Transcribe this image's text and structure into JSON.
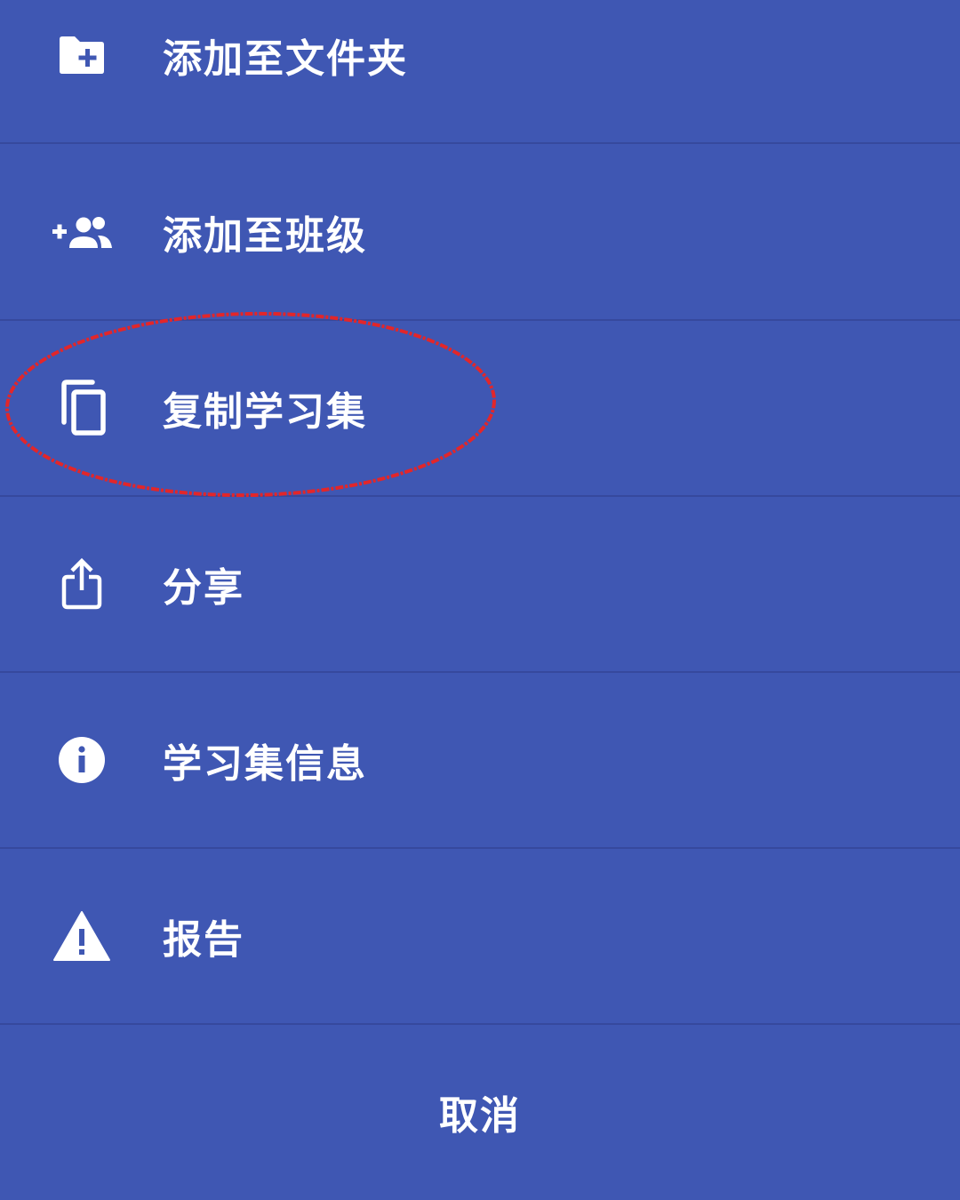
{
  "colors": {
    "background": "#3F57B3",
    "divider": "#36499D",
    "text": "#FFFFFF",
    "annotation": "#E2262A"
  },
  "menu": {
    "items": [
      {
        "label": "添加至文件夹",
        "icon": "folder-add-icon"
      },
      {
        "label": "添加至班级",
        "icon": "group-add-icon"
      },
      {
        "label": "复制学习集",
        "icon": "copy-icon"
      },
      {
        "label": "分享",
        "icon": "share-icon"
      },
      {
        "label": "学习集信息",
        "icon": "info-icon"
      },
      {
        "label": "报告",
        "icon": "warning-icon"
      }
    ]
  },
  "cancel": {
    "label": "取消"
  },
  "annotation": {
    "shape": "ellipse",
    "target": "复制学习集"
  }
}
